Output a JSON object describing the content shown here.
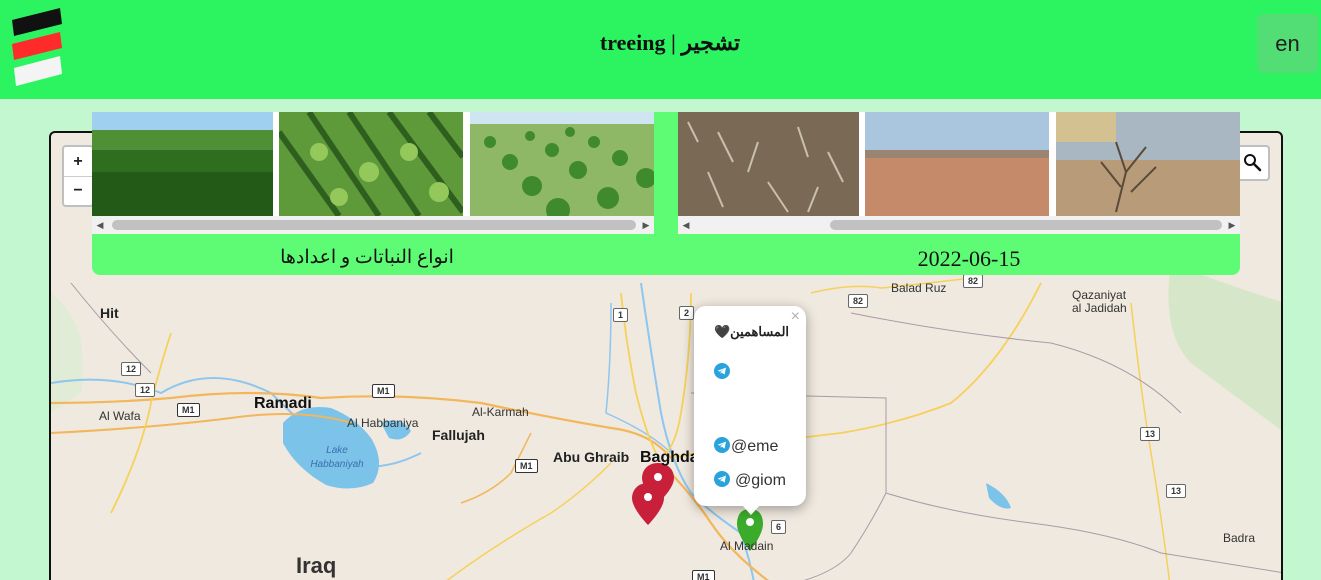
{
  "header": {
    "title": "treeing | تشجير",
    "language_button": "en",
    "logo": {
      "colors": [
        "#111111",
        "#ff2a2a",
        "#f4f4f4"
      ]
    }
  },
  "gallery": {
    "left_caption": "انواع النباتات و اعدادها",
    "right_caption": "2022-06-15",
    "left_photos": [
      "green-field-photo",
      "crop-rows-photo",
      "orchard-rows-photo"
    ],
    "right_photos": [
      "dry-stubble-field-photo",
      "barren-desert-photo",
      "dead-shrub-photo"
    ]
  },
  "map": {
    "controls": {
      "zoom_in": "+",
      "zoom_out": "−"
    },
    "places": {
      "hit": "Hit",
      "ramadi": "Ramadi",
      "al_wafa": "Al Wafa",
      "al_habbaniya": "Al Habbaniya",
      "lake_habbaniyah_1": "Lake",
      "lake_habbaniyah_2": "Habbaniyah",
      "fallujah": "Fallujah",
      "al_karmah": "Al-Karmah",
      "abu_ghraib": "Abu Ghraib",
      "baghdad": "Baghdad",
      "al_madain": "Al Madain",
      "balad_ruz": "Balad Ruz",
      "qazaniyat_1": "Qazaniyat",
      "qazaniyat_2": "al Jadidah",
      "badra": "Badra",
      "iraq": "Iraq"
    },
    "road_shields": [
      "12",
      "12",
      "M1",
      "M1",
      "M1",
      "1",
      "2",
      "82",
      "82",
      "13",
      "13",
      "6",
      "M1"
    ],
    "marker_colors": {
      "red": "#c8203b",
      "green": "#3bab2b"
    }
  },
  "popup": {
    "close": "×",
    "title": "المساهمين🖤",
    "handles": [
      "@eme",
      "@giom"
    ]
  }
}
